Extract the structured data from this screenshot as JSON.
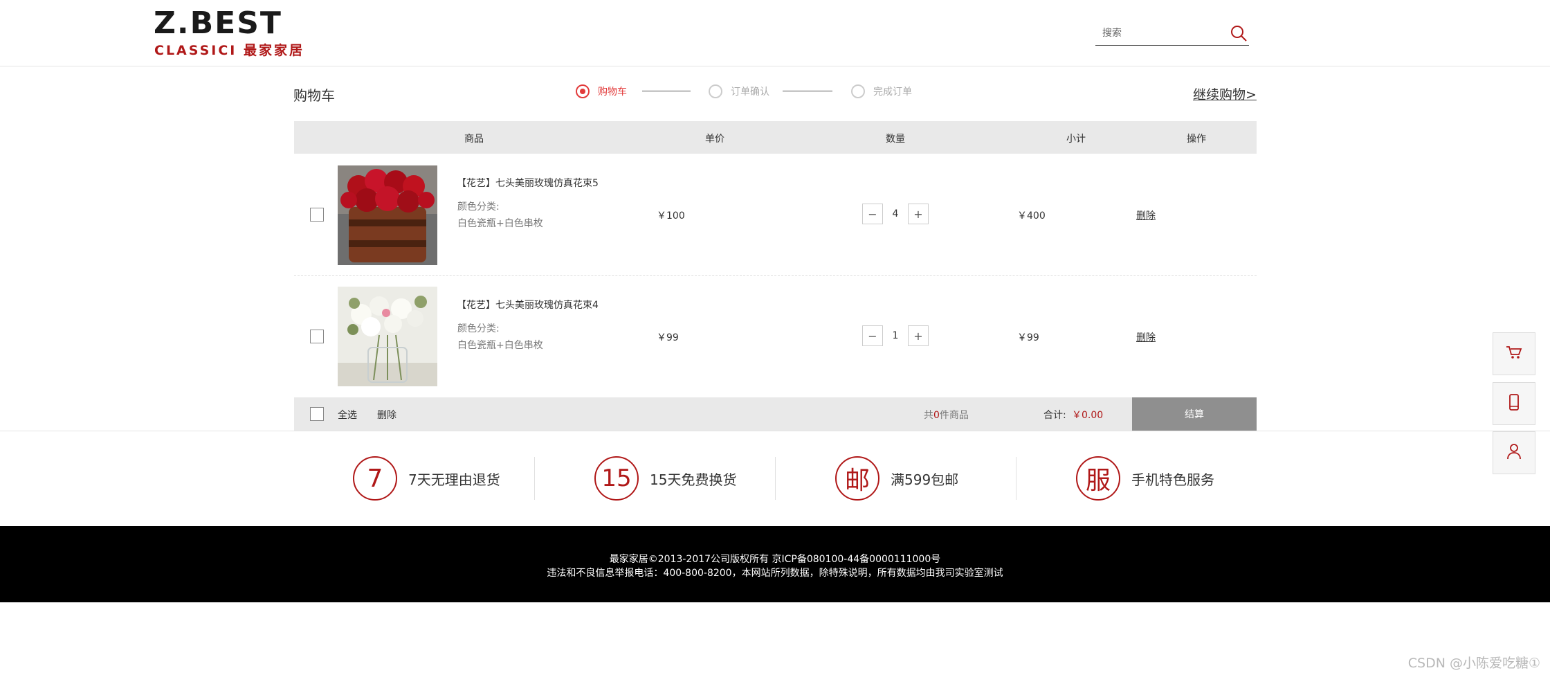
{
  "header": {
    "logo_main": "Z.BEST",
    "logo_sub": "CLASSICI 最家家居",
    "search_placeholder": "搜索"
  },
  "cart": {
    "page_title": "购物车",
    "steps": [
      "购物车",
      "订单确认",
      "完成订单"
    ],
    "continue_label": "继续购物>",
    "columns": [
      "商品",
      "单价",
      "数量",
      "小计",
      "操作"
    ],
    "items": [
      {
        "name": "【花艺】七头美丽玫瑰仿真花束5",
        "attr_label": "颜色分类:",
        "attr_value": "白色瓷瓶+白色串枚",
        "price": "￥100",
        "qty": "4",
        "subtotal": "￥400",
        "delete_label": "删除"
      },
      {
        "name": "【花艺】七头美丽玫瑰仿真花束4",
        "attr_label": "颜色分类:",
        "attr_value": "白色瓷瓶+白色串枚",
        "price": "￥99",
        "qty": "1",
        "subtotal": "￥99",
        "delete_label": "删除"
      }
    ],
    "qty_minus": "−",
    "qty_plus": "+",
    "footer": {
      "select_all": "全选",
      "delete": "删除",
      "count_prefix": "共",
      "count": "0",
      "count_suffix": "件商品",
      "total_label": "合计:",
      "total_value": "￥0.00",
      "checkout": "结算"
    }
  },
  "services": [
    {
      "icon": "7",
      "text": "7天无理由退货"
    },
    {
      "icon": "15",
      "text": "15天免费换货"
    },
    {
      "icon": "邮",
      "text": "满599包邮"
    },
    {
      "icon": "服",
      "text": "手机特色服务"
    }
  ],
  "footer": {
    "line1": "最家家居©2013-2017公司版权所有 京ICP备080100-44备0000111000号",
    "line2": "违法和不良信息举报电话：400-800-8200，本网站所列数据，除特殊说明，所有数据均由我司实验室测试"
  },
  "side_toolbar": [
    "cart-icon",
    "phone-icon",
    "user-icon"
  ],
  "watermark": "CSDN @小陈爱吃糖①",
  "colors": {
    "accent": "#b01818",
    "active_step": "#e23a3a",
    "checkout_bg": "#8f8f8f"
  }
}
